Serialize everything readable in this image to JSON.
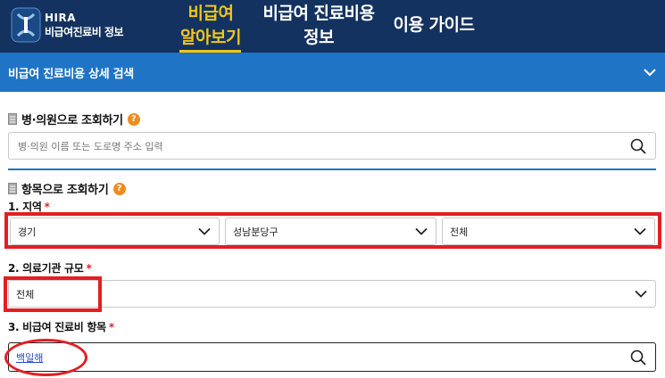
{
  "header": {
    "logo_title": "HIRA",
    "logo_subtitle": "비급여진료비 정보",
    "nav": [
      {
        "line1": "비급여",
        "line2": "알아보기",
        "active": true
      },
      {
        "line1": "비급여 진료비용",
        "line2": "정보",
        "active": false
      },
      {
        "line1": "이용 가이드",
        "line2": "",
        "active": false
      }
    ],
    "colors": {
      "header_bg": "#13325f",
      "active": "#f5c518"
    }
  },
  "subbar": {
    "title": "비급여 진료비용 상세 검색",
    "icon": "chevron-down-icon",
    "color": "#1f74c5"
  },
  "hospital_section": {
    "title": "병·의원으로 조회하기",
    "help": "?",
    "search_placeholder": "병·의원 이름 또는 도로명 주소 입력",
    "icon": "search-icon"
  },
  "item_section": {
    "title": "항목으로 조회하기",
    "help": "?",
    "region": {
      "label": "1. 지역",
      "required": "*",
      "selects": [
        "경기",
        "성남분당구",
        "전체"
      ]
    },
    "scale": {
      "label": "2. 의료기관 규모",
      "required": "*",
      "value": "전체"
    },
    "item": {
      "label": "3. 비급여 진료비 항목",
      "required": "*",
      "value": "백일해",
      "icon": "search-icon"
    }
  },
  "annotations": {
    "color": "#e31e24"
  }
}
